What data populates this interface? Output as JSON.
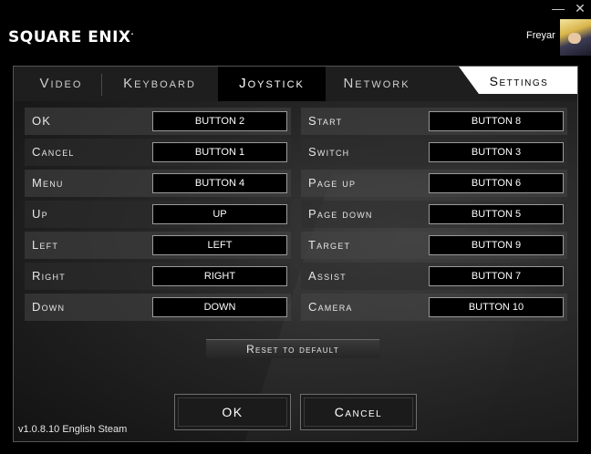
{
  "window": {
    "minimize_glyph": "—",
    "close_glyph": "✕"
  },
  "header": {
    "logo_text": "SQUARE ENIX",
    "logo_mark": ".",
    "username": "Freyar"
  },
  "tabs": [
    {
      "label": "Video"
    },
    {
      "label": "Keyboard"
    },
    {
      "label": "Joystick",
      "active": true
    },
    {
      "label": "Network"
    }
  ],
  "settings_tab": {
    "label": "Settings"
  },
  "bindings_left": [
    {
      "label": "OK",
      "value": "BUTTON 2"
    },
    {
      "label": "Cancel",
      "value": "BUTTON 1"
    },
    {
      "label": "Menu",
      "value": "BUTTON 4"
    },
    {
      "label": "Up",
      "value": "UP"
    },
    {
      "label": "Left",
      "value": "LEFT"
    },
    {
      "label": "Right",
      "value": "RIGHT"
    },
    {
      "label": "Down",
      "value": "DOWN"
    }
  ],
  "bindings_right": [
    {
      "label": "Start",
      "value": "BUTTON 8"
    },
    {
      "label": "Switch",
      "value": "BUTTON 3"
    },
    {
      "label": "Page up",
      "value": "BUTTON 6"
    },
    {
      "label": "Page down",
      "value": "BUTTON 5"
    },
    {
      "label": "Target",
      "value": "BUTTON 9"
    },
    {
      "label": "Assist",
      "value": "BUTTON 7"
    },
    {
      "label": "Camera",
      "value": "BUTTON 10"
    }
  ],
  "actions": {
    "reset_label": "Reset to default",
    "ok_label": "OK",
    "cancel_label": "Cancel"
  },
  "footer": {
    "version": "v1.0.8.10 English Steam"
  }
}
